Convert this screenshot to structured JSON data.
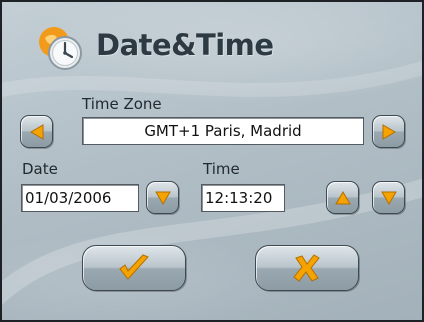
{
  "header": {
    "title": "Date&Time",
    "icon": "clock-globe-icon"
  },
  "timezone": {
    "label": "Time Zone",
    "value": "GMT+1 Paris, Madrid",
    "prev_icon": "arrow-left-icon",
    "next_icon": "arrow-right-icon"
  },
  "date": {
    "label": "Date",
    "value": "01/03/2006",
    "down_icon": "arrow-down-icon"
  },
  "time": {
    "label": "Time",
    "value": "12:13:20",
    "up_icon": "arrow-up-icon",
    "down_icon": "arrow-down-icon"
  },
  "actions": {
    "confirm_icon": "checkmark-icon",
    "cancel_icon": "cross-icon"
  },
  "colors": {
    "accent": "#f2a200",
    "text": "#2e3a43",
    "background": "#b1bec6"
  }
}
